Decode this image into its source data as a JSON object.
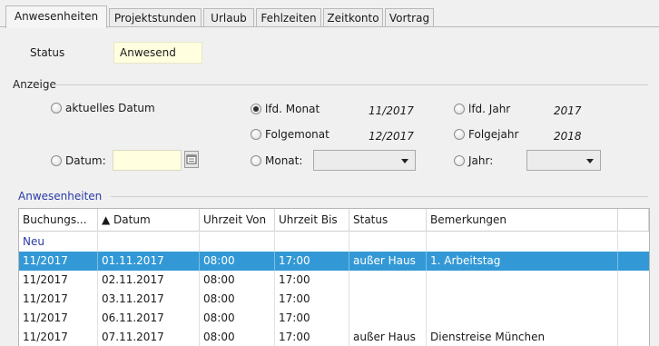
{
  "tabs": [
    {
      "label": "Anwesenheiten",
      "active": true
    },
    {
      "label": "Projektstunden",
      "active": false
    },
    {
      "label": "Urlaub",
      "active": false
    },
    {
      "label": "Fehlzeiten",
      "active": false
    },
    {
      "label": "Zeitkonto",
      "active": false
    },
    {
      "label": "Vortrag",
      "active": false
    }
  ],
  "status": {
    "label": "Status",
    "value": "Anwesend"
  },
  "anzeige": {
    "title": "Anzeige",
    "aktuelles_datum": {
      "label": "aktuelles Datum",
      "selected": false
    },
    "datum": {
      "label": "Datum:",
      "value": "",
      "selected": false
    },
    "lfd_monat": {
      "label": "lfd. Monat",
      "value": "11/2017",
      "selected": true
    },
    "folgemonat": {
      "label": "Folgemonat",
      "value": "12/2017",
      "selected": false
    },
    "monat": {
      "label": "Monat:",
      "value": "",
      "selected": false
    },
    "lfd_jahr": {
      "label": "lfd. Jahr",
      "value": "2017",
      "selected": false
    },
    "folgejahr": {
      "label": "Folgejahr",
      "value": "2018",
      "selected": false
    },
    "jahr": {
      "label": "Jahr:",
      "value": "",
      "selected": false
    }
  },
  "anwesenheiten": {
    "title": "Anwesenheiten",
    "columns": [
      "Buchungs...",
      "▲ Datum",
      "Uhrzeit Von",
      "Uhrzeit Bis",
      "Status",
      "Bemerkungen"
    ],
    "new_row_label": "Neu",
    "selected_row": 0,
    "rows": [
      [
        "11/2017",
        "01.11.2017",
        "08:00",
        "17:00",
        "außer Haus",
        "1. Arbeitstag"
      ],
      [
        "11/2017",
        "02.11.2017",
        "08:00",
        "17:00",
        "",
        ""
      ],
      [
        "11/2017",
        "03.11.2017",
        "08:00",
        "17:00",
        "",
        ""
      ],
      [
        "11/2017",
        "06.11.2017",
        "08:00",
        "17:00",
        "",
        ""
      ],
      [
        "11/2017",
        "07.11.2017",
        "08:00",
        "17:00",
        "außer Haus",
        "Dienstreise München"
      ]
    ]
  },
  "colors": {
    "accent": "#3399d6",
    "input_bg": "#ffffe0",
    "group_title": "#2a3aa8"
  },
  "icons": {
    "calendar_button": "calendar-icon",
    "dropdown": "chevron-down-icon"
  }
}
